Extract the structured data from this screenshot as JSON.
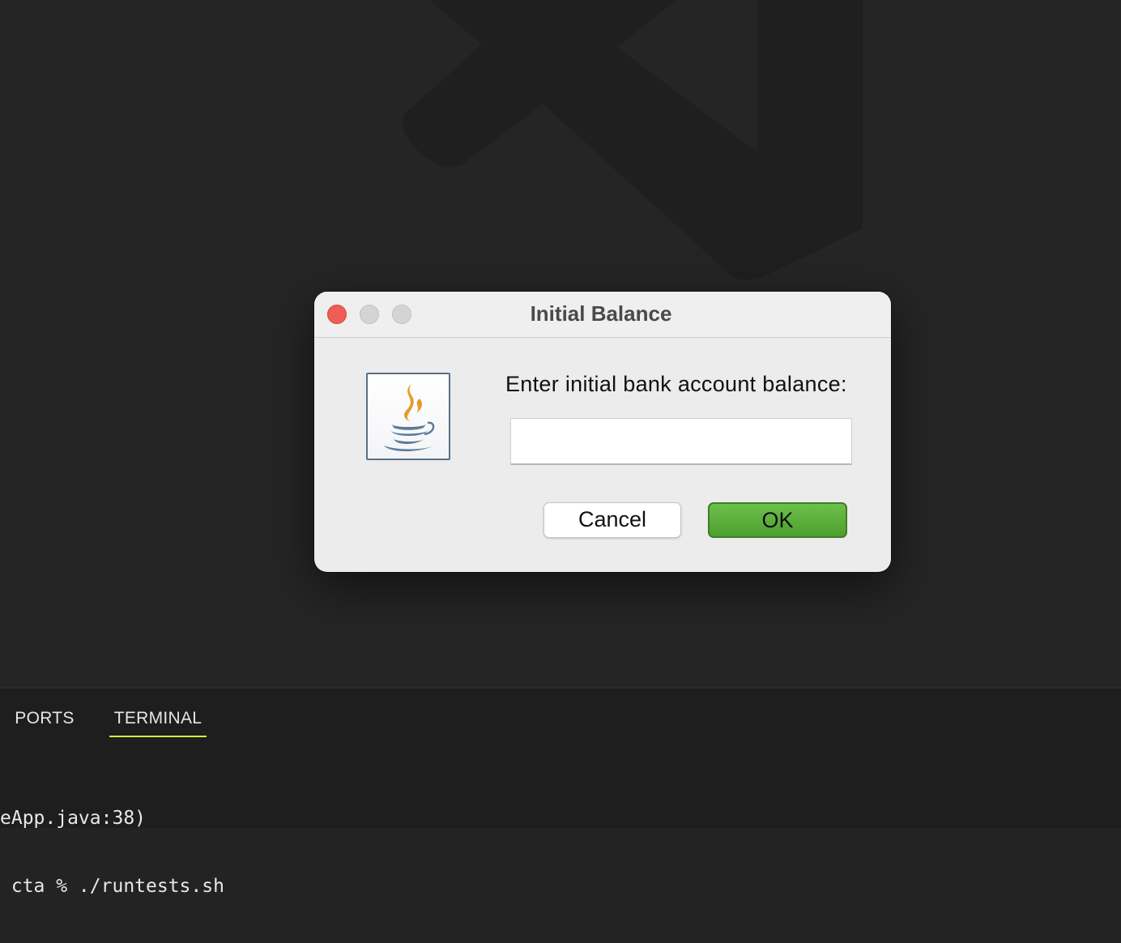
{
  "editor": {
    "watermark": "vscode-logo-icon"
  },
  "panel": {
    "tabs": [
      {
        "label": "PORTS"
      },
      {
        "label": "TERMINAL",
        "active": true
      }
    ],
    "terminal_lines": [
      "eApp.java:38)",
      " cta % ./runtests.sh"
    ],
    "active_tab_color": "#d6ec3c"
  },
  "dialog": {
    "title": "Initial Balance",
    "icon": "java-icon",
    "prompt": "Enter initial bank account balance:",
    "input": {
      "value": "",
      "placeholder": ""
    },
    "buttons": {
      "cancel_label": "Cancel",
      "ok_label": "OK"
    },
    "colors": {
      "close": "#ee5e56",
      "ok_button": "#5bb03c"
    }
  }
}
